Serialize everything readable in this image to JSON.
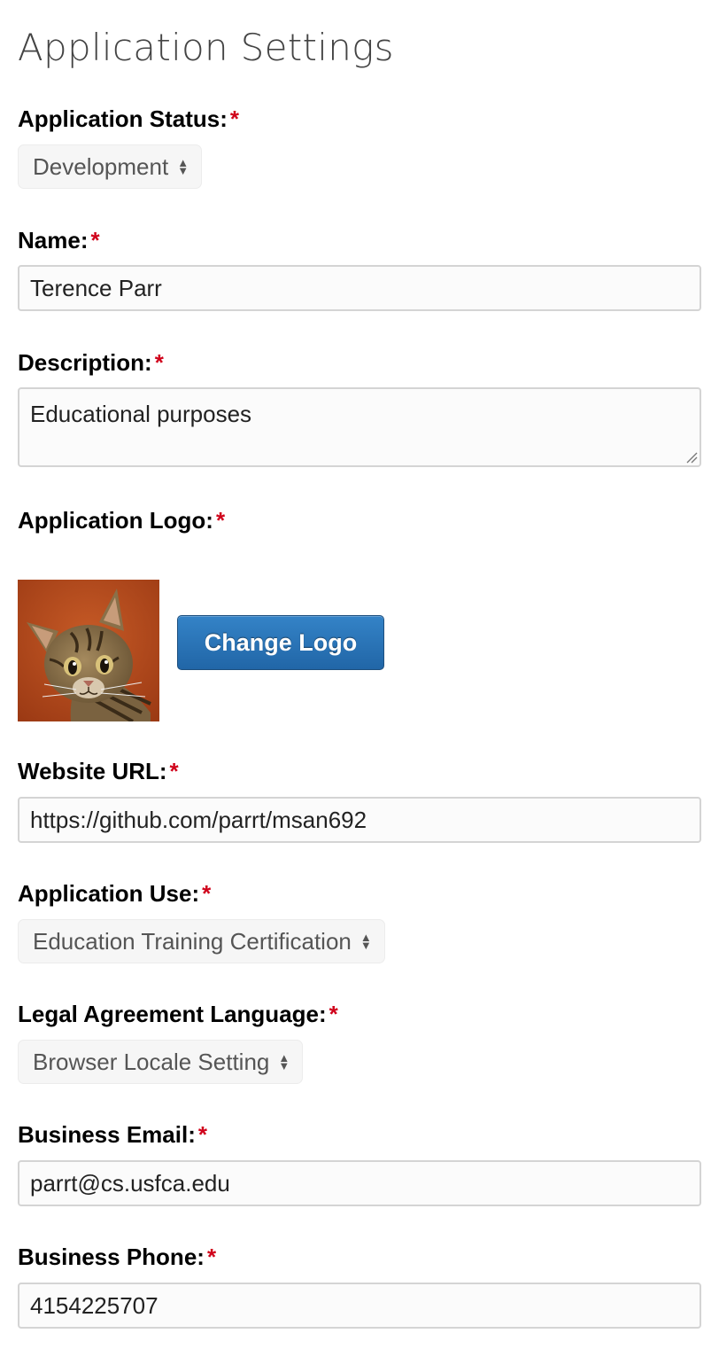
{
  "page": {
    "title": "Application Settings"
  },
  "required_marker": "*",
  "form": {
    "status": {
      "label": "Application Status:",
      "value": "Development"
    },
    "name": {
      "label": "Name:",
      "value": "Terence Parr"
    },
    "description": {
      "label": "Description:",
      "value": "Educational purposes"
    },
    "logo": {
      "label": "Application Logo:",
      "button_label": "Change Logo"
    },
    "website": {
      "label": "Website URL:",
      "value": "https://github.com/parrt/msan692"
    },
    "use": {
      "label": "Application Use:",
      "value": "Education Training Certification"
    },
    "legal_language": {
      "label": "Legal Agreement Language:",
      "value": "Browser Locale Setting"
    },
    "email": {
      "label": "Business Email:",
      "value": "parrt@cs.usfca.edu"
    },
    "phone": {
      "label": "Business Phone:",
      "value": "4154225707"
    }
  },
  "icons": {
    "select_arrows": "select-arrows-icon",
    "resize": "resize-handle-icon",
    "logo_image": "cat-logo"
  },
  "colors": {
    "required": "#d0021b",
    "button": "#2a73b6",
    "title": "#444444"
  }
}
